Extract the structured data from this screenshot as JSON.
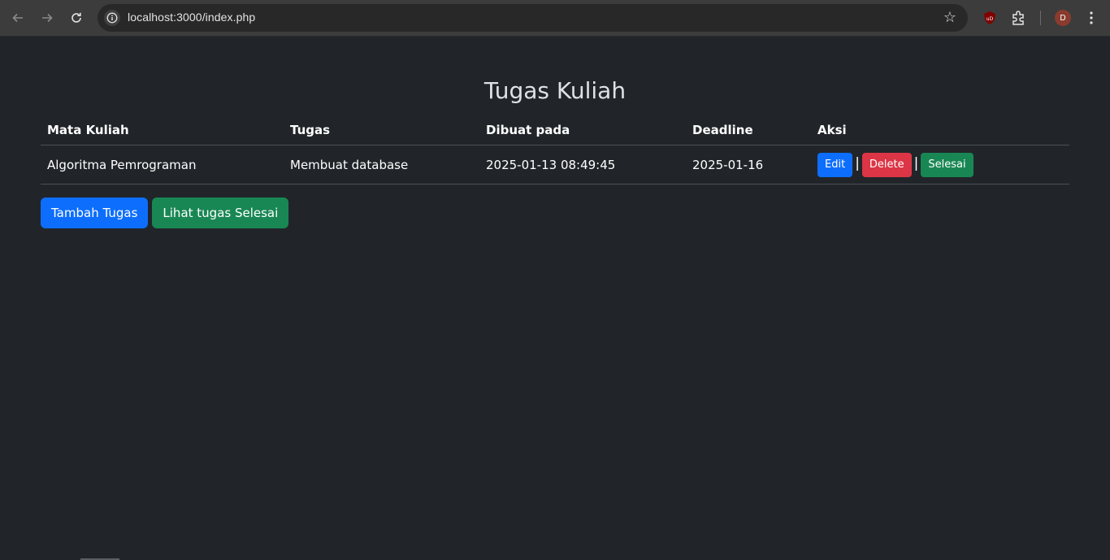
{
  "browser": {
    "url": "localhost:3000/index.php",
    "avatar_letter": "D",
    "nav": {
      "back_icon": "arrow-left-icon",
      "forward_icon": "arrow-right-icon",
      "reload_icon": "reload-icon"
    }
  },
  "page": {
    "title": "Tugas Kuliah"
  },
  "table": {
    "headers": [
      "Mata Kuliah",
      "Tugas",
      "Dibuat pada",
      "Deadline",
      "Aksi"
    ],
    "rows": [
      {
        "mata_kuliah": "Algoritma Pemrograman",
        "tugas": "Membuat database",
        "dibuat_pada": "2025-01-13 08:49:45",
        "deadline": "2025-01-16",
        "actions": {
          "edit": "Edit",
          "delete": "Delete",
          "done": "Selesai",
          "separator": "|"
        }
      }
    ]
  },
  "bottom_actions": {
    "add": "Tambah Tugas",
    "view_done": "Lihat tugas Selesai"
  },
  "colors": {
    "background": "#212529",
    "primary": "#0d6efd",
    "danger": "#dc3545",
    "success": "#198754"
  }
}
